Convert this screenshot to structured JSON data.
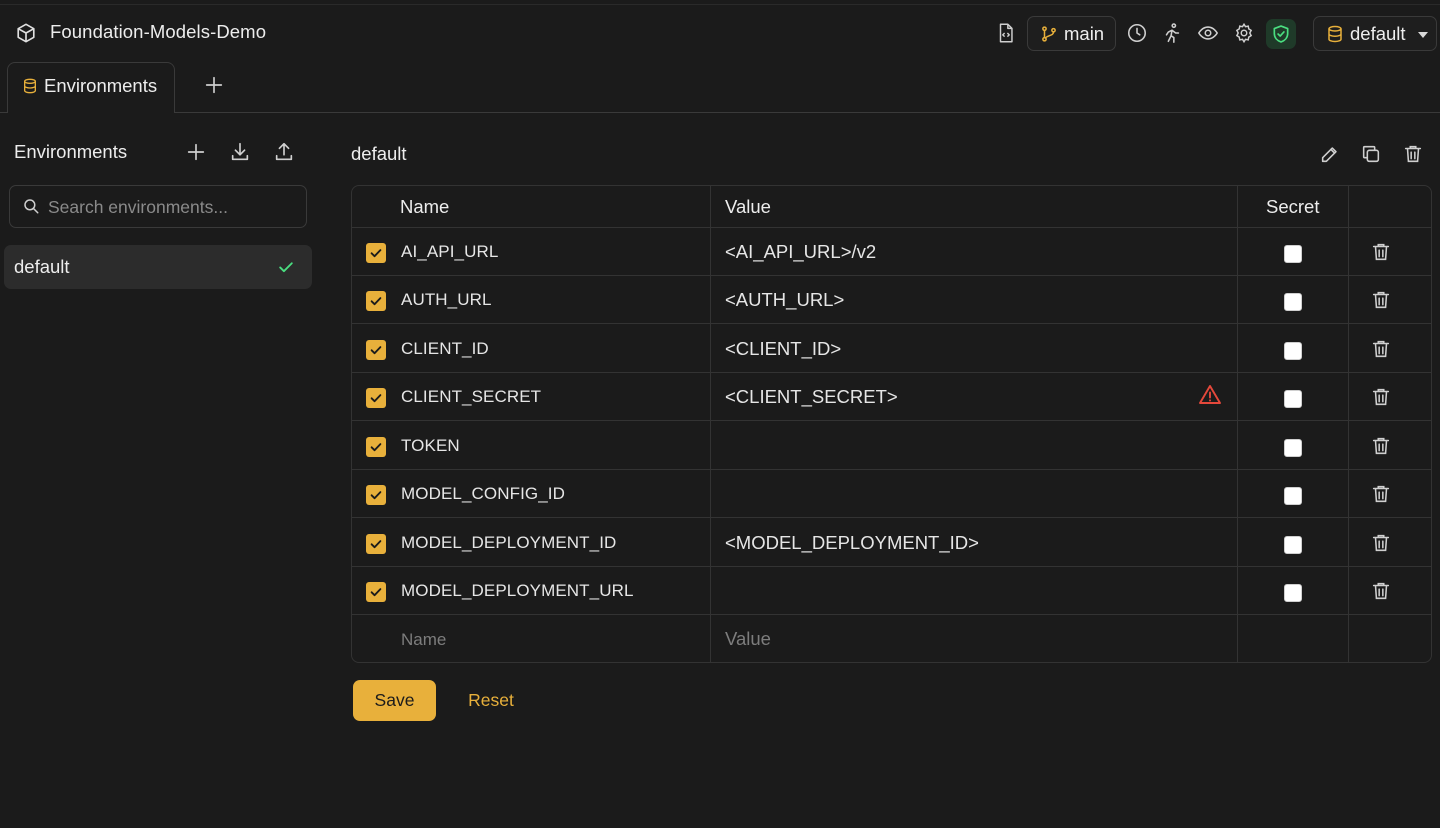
{
  "app": {
    "title": "Foundation-Models-Demo"
  },
  "header": {
    "branch": "main",
    "environment_selected": "default",
    "icons": [
      "file-code-icon",
      "branch-icon",
      "history-icon",
      "runner-icon",
      "eye-icon",
      "gear-icon",
      "shield-check-icon",
      "database-icon",
      "chevron-down-icon"
    ]
  },
  "tabs": [
    {
      "label": "Environments",
      "icon": "database-icon"
    }
  ],
  "sidebar": {
    "title": "Environments",
    "search_placeholder": "Search environments...",
    "items": [
      {
        "label": "default",
        "selected": true
      }
    ]
  },
  "main": {
    "title": "default",
    "columns": {
      "name": "Name",
      "value": "Value",
      "secret": "Secret"
    },
    "rows": [
      {
        "name": "AI_API_URL",
        "value": "<AI_API_URL>/v2",
        "enabled": true,
        "secret": false,
        "warning": false
      },
      {
        "name": "AUTH_URL",
        "value": "<AUTH_URL>",
        "enabled": true,
        "secret": false,
        "warning": false
      },
      {
        "name": "CLIENT_ID",
        "value": "<CLIENT_ID>",
        "enabled": true,
        "secret": false,
        "warning": false
      },
      {
        "name": "CLIENT_SECRET",
        "value": "<CLIENT_SECRET>",
        "enabled": true,
        "secret": false,
        "warning": true
      },
      {
        "name": "TOKEN",
        "value": "",
        "enabled": true,
        "secret": false,
        "warning": false
      },
      {
        "name": "MODEL_CONFIG_ID",
        "value": "",
        "enabled": true,
        "secret": false,
        "warning": false
      },
      {
        "name": "MODEL_DEPLOYMENT_ID",
        "value": "<MODEL_DEPLOYMENT_ID>",
        "enabled": true,
        "secret": false,
        "warning": false
      },
      {
        "name": "MODEL_DEPLOYMENT_URL",
        "value": "",
        "enabled": true,
        "secret": false,
        "warning": false
      }
    ],
    "new_row": {
      "name_placeholder": "Name",
      "value_placeholder": "Value"
    },
    "save_label": "Save",
    "reset_label": "Reset"
  },
  "colors": {
    "accent": "#e8b03b",
    "background": "#1b1b1b",
    "success": "#4ade80",
    "warning": "#e5483b"
  }
}
